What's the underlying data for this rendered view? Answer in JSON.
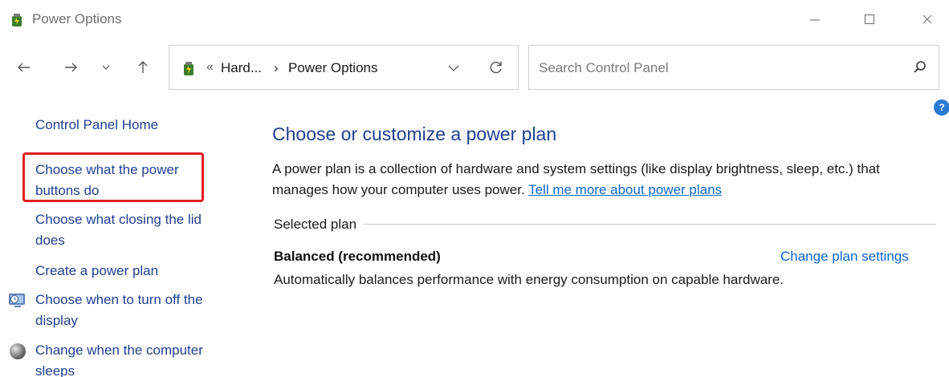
{
  "window": {
    "title": "Power Options"
  },
  "addressbar": {
    "separator": "«",
    "breadcrumb_parent": "Hard...",
    "arrow": "›",
    "breadcrumb_current": "Power Options"
  },
  "search": {
    "placeholder": "Search Control Panel",
    "value": ""
  },
  "help": {
    "label": "?"
  },
  "sidebar": {
    "items": [
      {
        "label": "Control Panel Home"
      },
      {
        "label": "Choose what the power buttons do"
      },
      {
        "label": "Choose what closing the lid does"
      },
      {
        "label": "Create a power plan"
      },
      {
        "label": "Choose when to turn off the display"
      },
      {
        "label": "Change when the computer sleeps"
      }
    ]
  },
  "main": {
    "title": "Choose or customize a power plan",
    "description": "A power plan is a collection of hardware and system settings (like display brightness, sleep, etc.) that manages how your computer uses power. ",
    "learn_more_link": "Tell me more about power plans",
    "selected_plan_label": "Selected plan",
    "plan": {
      "name": "Balanced (recommended)",
      "change_link": "Change plan settings",
      "description": "Automatically balances performance with energy consumption on capable hardware."
    }
  },
  "colors": {
    "link_blue": "#0b66d0",
    "nav_blue": "#1f3f8f",
    "highlight_red": "#e02020"
  }
}
